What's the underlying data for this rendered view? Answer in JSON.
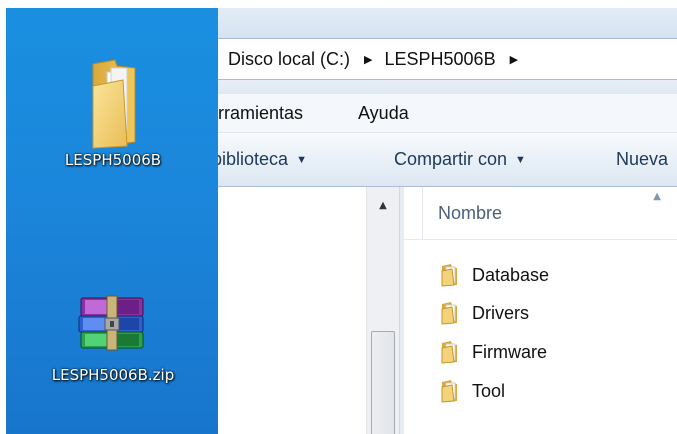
{
  "desktop": {
    "folder_label": "LESPH5006B",
    "zip_label": "LESPH5006B.zip"
  },
  "explorer": {
    "breadcrumb": [
      "Disco local (C:)",
      "LESPH5006B"
    ],
    "menu": [
      "rramientas",
      "Ayuda"
    ],
    "toolbar": [
      "ibiblioteca",
      "Compartir con",
      "Nueva"
    ],
    "column_header": "Nombre",
    "files": [
      "Database",
      "Drivers",
      "Firmware",
      "Tool"
    ]
  },
  "icons": {
    "folder": "folder-icon",
    "archive": "winrar-archive-icon",
    "caret": "chevron-down-icon",
    "breadcrumb_sep": "chevron-right-icon",
    "scroll_up": "scroll-up-arrow-icon"
  },
  "colors": {
    "desktop_bg": "#1a8fe0",
    "toolbar_text": "#1e395b",
    "header_text": "#4c607a"
  }
}
